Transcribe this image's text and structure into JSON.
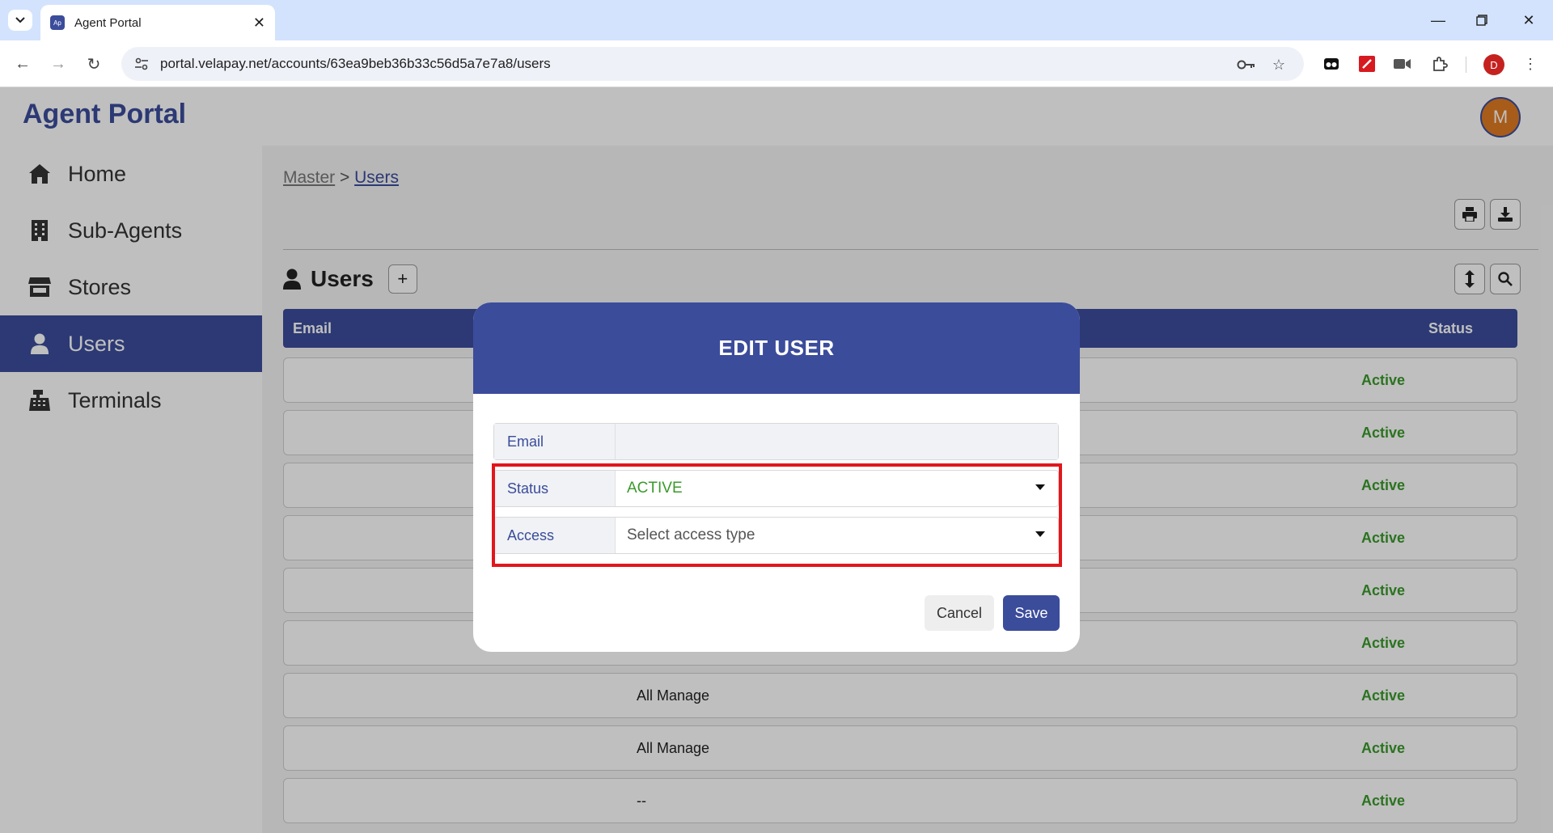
{
  "browser": {
    "tab_title": "Agent Portal",
    "favicon_text": "Ap",
    "url": "portal.velapay.net/accounts/63ea9beb36b33c56d5a7e7a8/users",
    "profile_initial": "D"
  },
  "app": {
    "brand": "Agent Portal",
    "avatar_initial": "M",
    "sidebar": {
      "items": [
        {
          "label": "Home",
          "icon": "home-icon",
          "active": false
        },
        {
          "label": "Sub-Agents",
          "icon": "building-icon",
          "active": false
        },
        {
          "label": "Stores",
          "icon": "store-icon",
          "active": false
        },
        {
          "label": "Users",
          "icon": "user-icon",
          "active": true
        },
        {
          "label": "Terminals",
          "icon": "cash-register-icon",
          "active": false
        }
      ]
    },
    "breadcrumb": {
      "root": "Master",
      "separator": ">",
      "current": "Users"
    },
    "section_title": "Users",
    "table": {
      "columns": {
        "email": "Email",
        "status": "Status"
      },
      "rows": [
        {
          "access": "",
          "status": "Active"
        },
        {
          "access": "",
          "status": "Active"
        },
        {
          "access": "",
          "status": "Active"
        },
        {
          "access": "",
          "status": "Active"
        },
        {
          "access": "",
          "status": "Active"
        },
        {
          "access": "",
          "status": "Active"
        },
        {
          "access": "All Manage",
          "status": "Active"
        },
        {
          "access": "All Manage",
          "status": "Active"
        },
        {
          "access": "--",
          "status": "Active"
        }
      ]
    }
  },
  "modal": {
    "title": "EDIT USER",
    "fields": {
      "email": {
        "label": "Email",
        "value": ""
      },
      "status": {
        "label": "Status",
        "value": "ACTIVE"
      },
      "access": {
        "label": "Access",
        "placeholder": "Select access type"
      }
    },
    "cancel_label": "Cancel",
    "save_label": "Save"
  },
  "colors": {
    "brand": "#3b4c9b",
    "status_active": "#3a9a2b",
    "highlight": "#e2161d",
    "avatar": "#e07b22"
  }
}
